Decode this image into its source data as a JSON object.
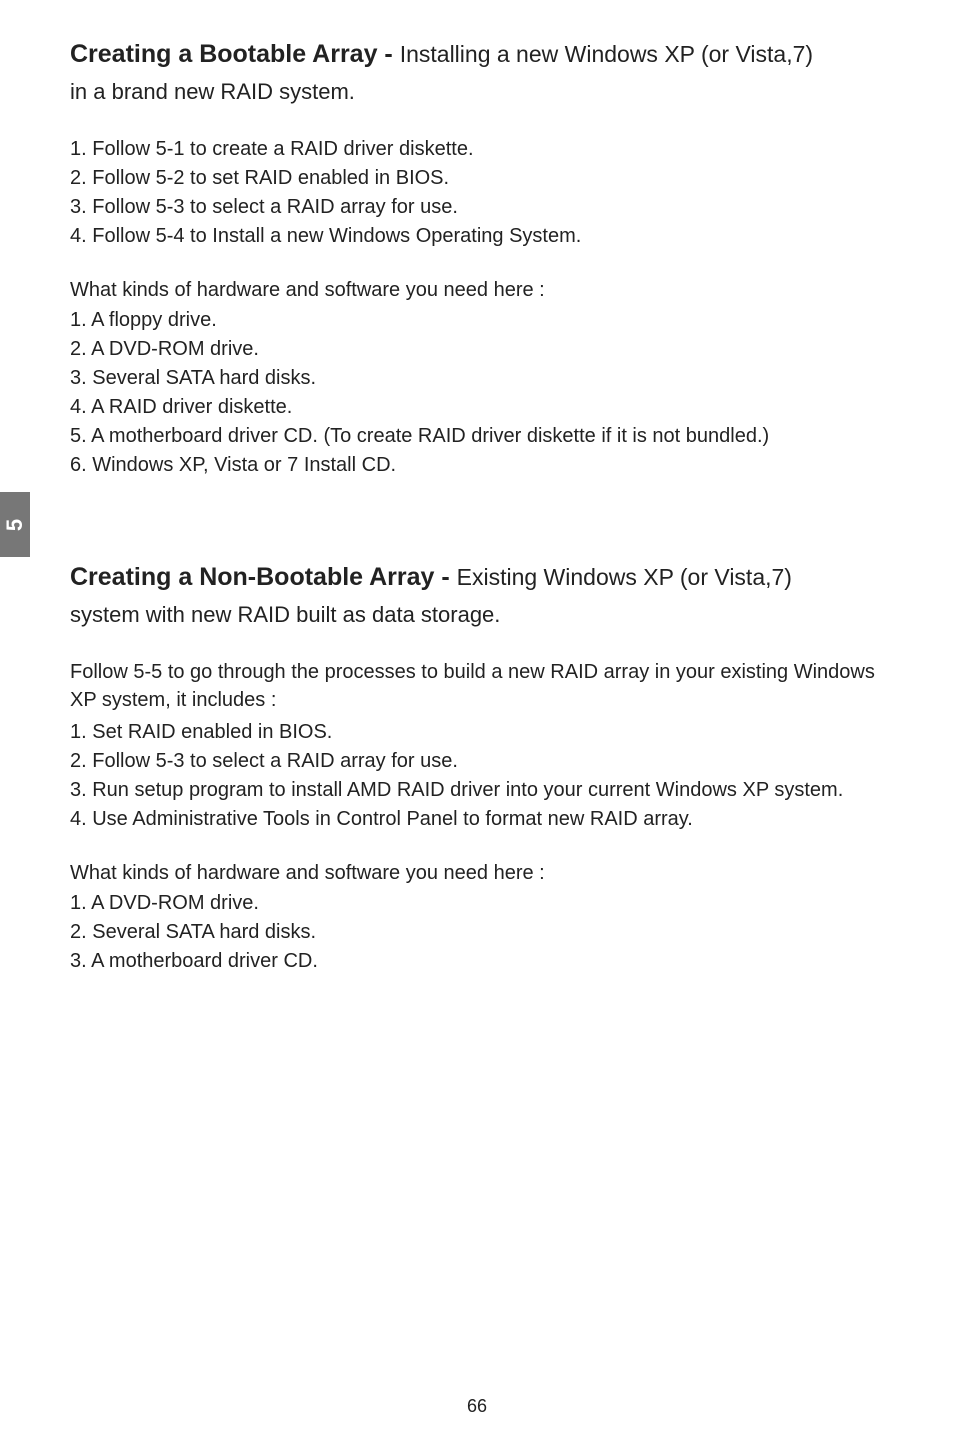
{
  "sideTab": "5",
  "section1": {
    "headingBold": "Creating a Bootable Array - ",
    "headingNormal": "Installing a new Windows XP (or Vista,7)",
    "subLine": "in a brand new RAID system.",
    "steps": [
      "1. Follow 5-1 to create a RAID driver diskette.",
      "2. Follow 5-2 to set RAID enabled in BIOS.",
      "3. Follow 5-3 to select a RAID array for use.",
      "4. Follow 5-4 to Install a new Windows Operating System."
    ],
    "needsPrompt": "What kinds of hardware and software you need here :",
    "needs": [
      "1. A floppy drive.",
      "2. A DVD-ROM drive.",
      "3. Several SATA hard disks.",
      "4. A RAID driver diskette.",
      "5. A motherboard driver CD. (To create RAID driver diskette if it is not bundled.)",
      "6. Windows XP, Vista or 7 Install CD."
    ]
  },
  "section2": {
    "headingBold": "Creating a Non-Bootable Array - ",
    "headingNormal": "Existing Windows XP (or Vista,7)",
    "subLine": "system with new RAID built as data storage.",
    "introPara": "Follow 5-5 to go through the processes to build a new RAID array in your existing Windows XP system, it includes :",
    "steps": [
      "1. Set RAID enabled in BIOS.",
      "2. Follow 5-3 to select a RAID array for use.",
      "3. Run setup program to install AMD RAID driver into your current Windows XP system.",
      "4. Use Administrative Tools in Control Panel to format new RAID array."
    ],
    "needsPrompt": "What kinds of hardware and software you need here :",
    "needs": [
      "1. A DVD-ROM drive.",
      "2. Several SATA hard disks.",
      "3. A motherboard driver CD."
    ]
  },
  "pageNumber": "66"
}
